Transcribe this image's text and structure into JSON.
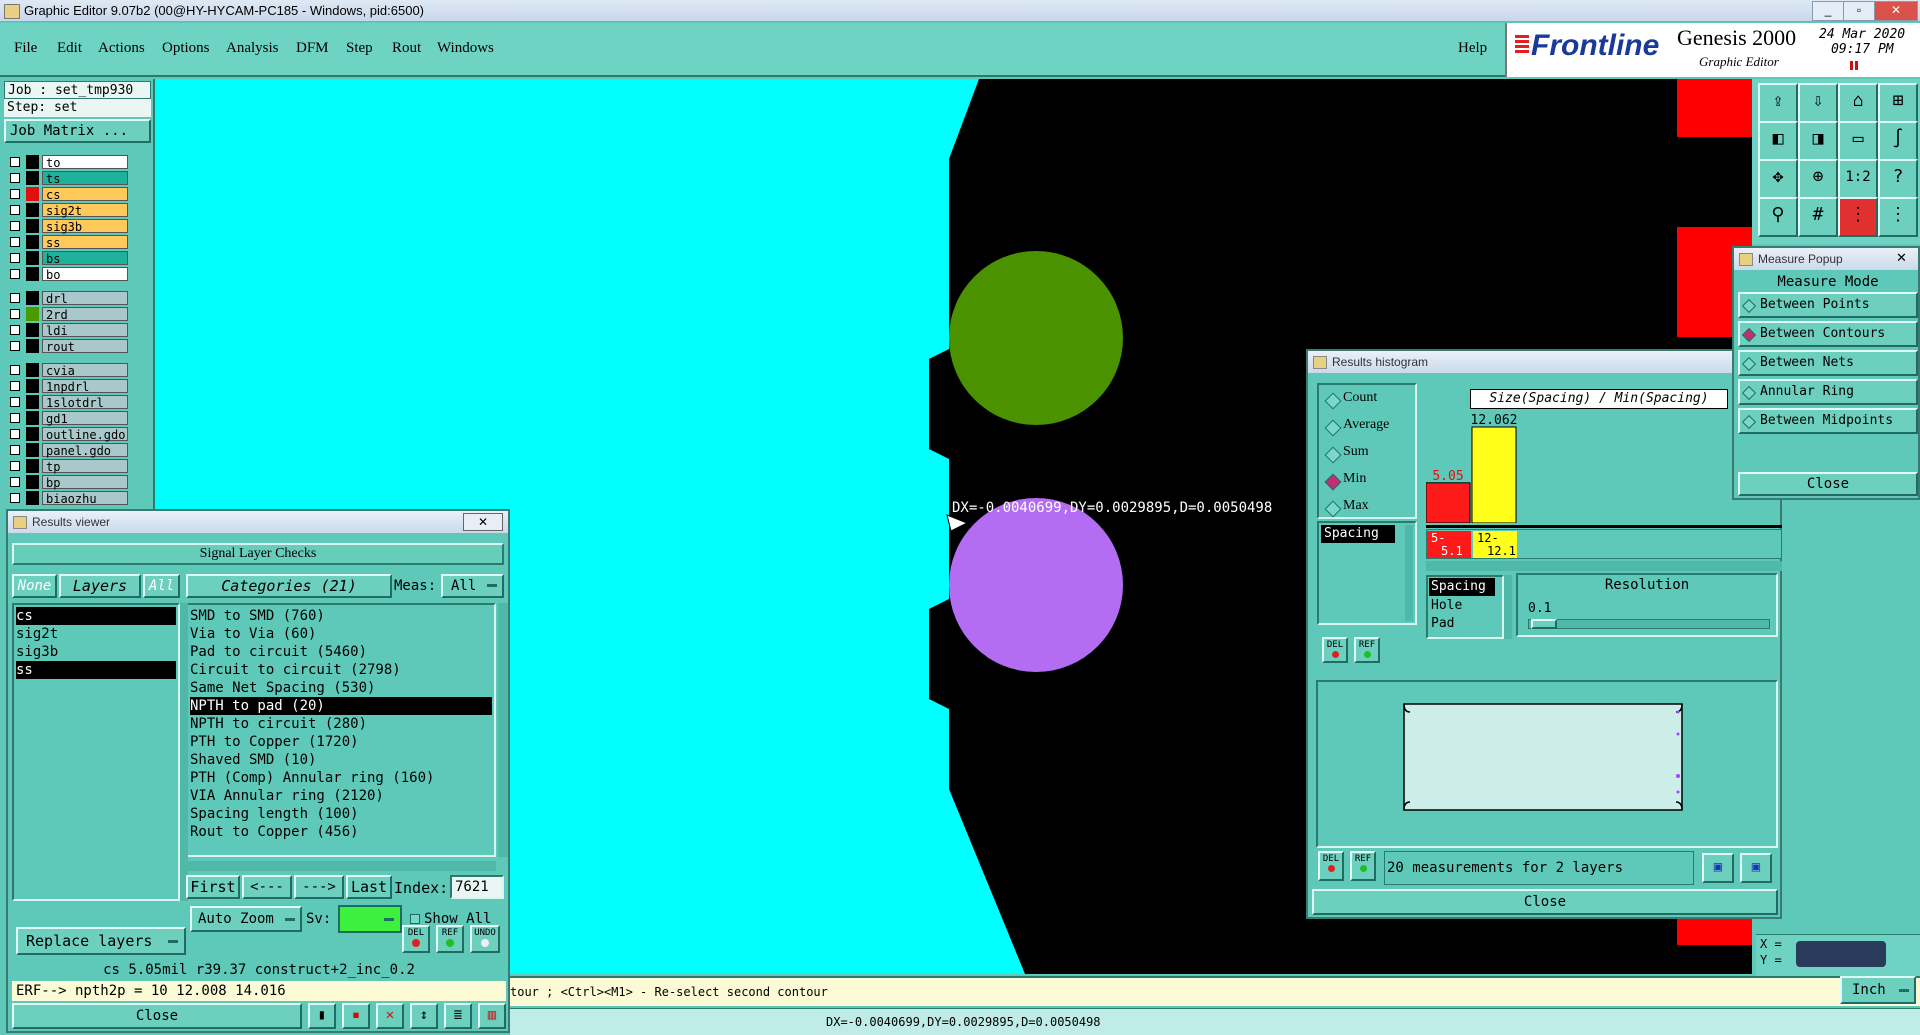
{
  "titlebar": {
    "title": "Graphic Editor 9.07b2 (00@HY-HYCAM-PC185 - Windows, pid:6500)",
    "minimize": "_",
    "restore": "▫",
    "close": "✕"
  },
  "menu": {
    "items": [
      "File",
      "Edit",
      "Actions",
      "Options",
      "Analysis",
      "DFM",
      "Step",
      "Rout",
      "Windows"
    ],
    "help": "Help"
  },
  "brand": {
    "logo": "Frontline",
    "product": "Genesis 2000",
    "subtitle": "Graphic Editor",
    "date": "24 Mar 2020",
    "time": "09:17 PM"
  },
  "job": {
    "job": "Job : set_tmp930",
    "step": "Step: set",
    "matrix_button": "Job Matrix ..."
  },
  "layers": [
    {
      "name": "to",
      "bg": "#ffffff",
      "sw": "#000000"
    },
    {
      "name": "ts",
      "bg": "#1fb19a",
      "sw": "#000000"
    },
    {
      "name": "cs",
      "bg": "#ffc95a",
      "sw": "#e01010"
    },
    {
      "name": "sig2t",
      "bg": "#ffc95a",
      "sw": "#000000"
    },
    {
      "name": "sig3b",
      "bg": "#ffc95a",
      "sw": "#000000"
    },
    {
      "name": "ss",
      "bg": "#ffc95a",
      "sw": "#000000"
    },
    {
      "name": "bs",
      "bg": "#1fb19a",
      "sw": "#000000"
    },
    {
      "name": "bo",
      "bg": "#ffffff",
      "sw": "#000000"
    },
    {
      "name": "drl",
      "bg": "#a8c8cc",
      "sw": "#000000"
    },
    {
      "name": "2rd",
      "bg": "#a8c8cc",
      "sw": "#4a9a00"
    },
    {
      "name": "ldi",
      "bg": "#a8c8cc",
      "sw": "#000000"
    },
    {
      "name": "rout",
      "bg": "#a8c8cc",
      "sw": "#000000"
    },
    {
      "name": "cvia",
      "bg": "#a8c8cc",
      "sw": "#000000"
    },
    {
      "name": "1npdrl",
      "bg": "#a8c8cc",
      "sw": "#000000"
    },
    {
      "name": "1slotdrl",
      "bg": "#a8c8cc",
      "sw": "#000000"
    },
    {
      "name": "gd1",
      "bg": "#a8c8cc",
      "sw": "#000000"
    },
    {
      "name": "outline.gdo",
      "bg": "#a8c8cc",
      "sw": "#000000"
    },
    {
      "name": "panel.gdo",
      "bg": "#a8c8cc",
      "sw": "#000000"
    },
    {
      "name": "tp",
      "bg": "#a8c8cc",
      "sw": "#000000"
    },
    {
      "name": "bp",
      "bg": "#a8c8cc",
      "sw": "#000000"
    },
    {
      "name": "biaozhu",
      "bg": "#a8c8cc",
      "sw": "#000000"
    }
  ],
  "canvas": {
    "measure_text": "DX=-0.0040699,DY=0.0029895,D=0.0050498",
    "copper": "#00ffff",
    "green_pad": "#4a9200",
    "purple_pad": "#b36cf2"
  },
  "results_viewer": {
    "title": "Results viewer",
    "header": "Signal Layer Checks",
    "none": "None",
    "layers_tab": "Layers",
    "all": "All",
    "categories_label": "Categories (21)",
    "meas_label": "Meas:",
    "meas_value": "All",
    "layer_list": [
      "cs",
      "sig2t",
      "sig3b",
      "ss"
    ],
    "categories": [
      "SMD to SMD (760)",
      "Via to Via (60)",
      "Pad to circuit (5460)",
      "Circuit to circuit (2798)",
      "Same Net Spacing (530)",
      "NPTH to pad (20)",
      "NPTH to circuit (280)",
      "PTH to Copper (1720)",
      "Shaved SMD (10)",
      "PTH (Comp) Annular ring (160)",
      "VIA Annular ring (2120)",
      "Spacing length (100)",
      "Rout to Copper (456)"
    ],
    "first": "First",
    "prev": "<---",
    "next": "--->",
    "last": "Last",
    "index_label": "Index:",
    "index_value": "7621",
    "auto_zoom": "Auto Zoom",
    "sv_label": "Sv:",
    "show_all": "Show All",
    "del": "DEL",
    "ref": "REF",
    "undo": "UNDO",
    "replace_layers": "Replace layers",
    "status": "cs 5.05mil  r39.37  construct+2_inc_0.2",
    "erf": "ERF--> npth2p = 10 12.008 14.016",
    "close": "Close"
  },
  "histogram": {
    "title": "Results histogram",
    "modes": [
      "Count",
      "Average",
      "Sum",
      "Min",
      "Max"
    ],
    "selected_mode": "Min",
    "chart_title": "Size(Spacing) / Min(Spacing)",
    "list": [
      "Spacing"
    ],
    "types": [
      "Spacing",
      "Hole",
      "Pad"
    ],
    "resolution_label": "Resolution",
    "resolution_value": "0.1",
    "summary": "20 measurements for 2 layers",
    "del": "DEL",
    "ref": "REF",
    "close": "Close"
  },
  "chart_data": {
    "type": "bar",
    "title": "Size(Spacing) / Min(Spacing)",
    "categories": [
      "5-\n5.1",
      "12-\n12.1"
    ],
    "cat_labels": [
      [
        "5-",
        "5.1"
      ],
      [
        "12-",
        "12.1"
      ]
    ],
    "values": [
      5.05,
      12.062
    ],
    "value_labels": [
      "5.05",
      "12.062"
    ],
    "colors": [
      "#ff1a1a",
      "#ffff1a"
    ],
    "ylim": [
      0,
      12.062
    ]
  },
  "measure_popup": {
    "title": "Measure Popup",
    "mode_label": "Measure Mode",
    "modes": [
      "Between Points",
      "Between Contours",
      "Between Nets",
      "Annular Ring",
      "Between Midpoints"
    ],
    "selected": "Between Contours",
    "close": "Close"
  },
  "statusbar": {
    "prompt": "tour ; <Ctrl><M1> - Re-select second contour",
    "measure": "DX=-0.0040699,DY=0.0029895,D=0.0050498",
    "units": "Inch",
    "x_label": "X =",
    "y_label": "Y ="
  }
}
